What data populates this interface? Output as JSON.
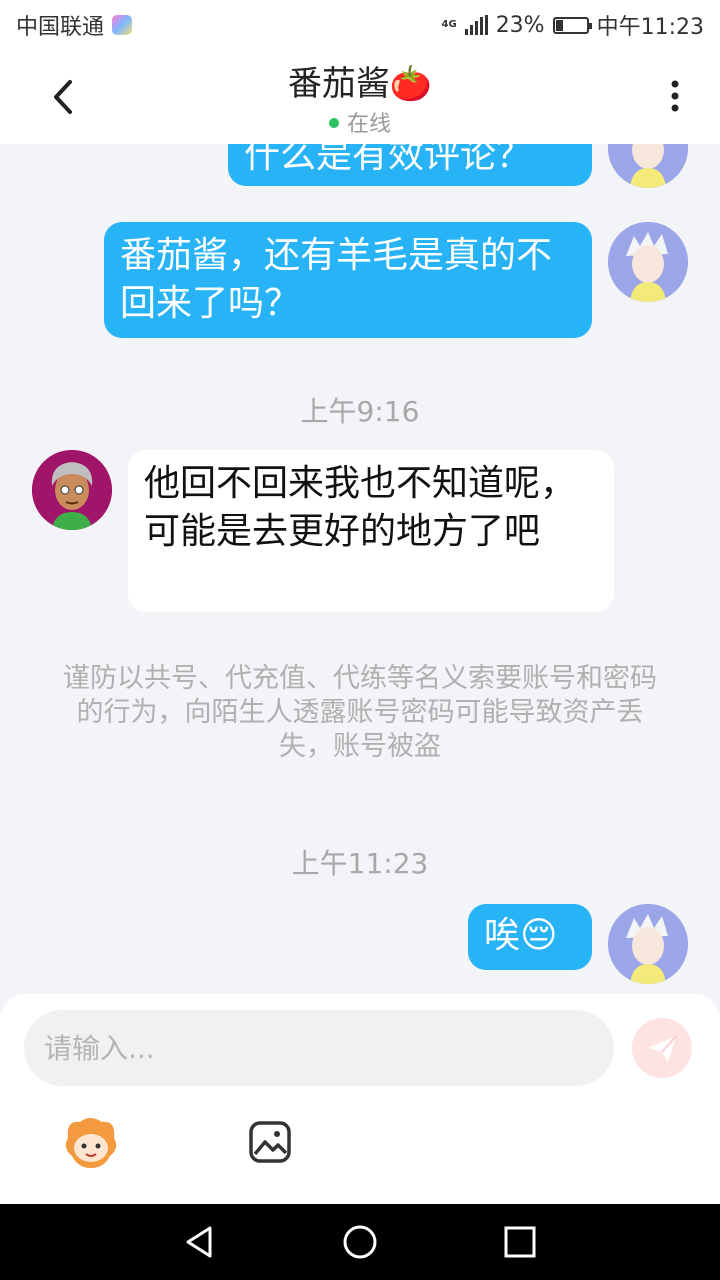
{
  "status_bar": {
    "carrier": "中国联通",
    "network": "4G",
    "battery_percent": "23%",
    "battery_level": 0.23,
    "time": "中午11:23"
  },
  "header": {
    "title": "番茄酱🍅",
    "status": "在线",
    "back_icon": "chevron-left-icon",
    "more_icon": "more-vertical-icon"
  },
  "messages": [
    {
      "sender": "me",
      "text": "什么是有效评论？"
    },
    {
      "sender": "me",
      "text": "番茄酱，还有羊毛是真的不回来了吗？"
    },
    {
      "type": "time",
      "text": "上午9:16"
    },
    {
      "sender": "other",
      "text": "他回不回来我也不知道呢，可能是去更好的地方了吧"
    },
    {
      "type": "notice",
      "text": "谨防以共号、代充值、代练等名义索要账号和密码的行为，向陌生人透露账号密码可能导致资产丢失，账号被盗"
    },
    {
      "type": "time",
      "text": "上午11:23"
    },
    {
      "sender": "me",
      "text": "唉😔"
    }
  ],
  "composer": {
    "placeholder": "请输入...",
    "value": "",
    "send_icon": "send-icon",
    "emoji_icon": "emoji-mascot-icon",
    "image_icon": "image-icon"
  },
  "navigation": {
    "back_icon": "nav-back-icon",
    "home_icon": "nav-home-icon",
    "recents_icon": "nav-recents-icon"
  },
  "colors": {
    "my_bubble": "#27b3f5",
    "their_bubble": "#ffffff",
    "online_dot": "#2bc15f",
    "background": "#f2f4f7"
  }
}
